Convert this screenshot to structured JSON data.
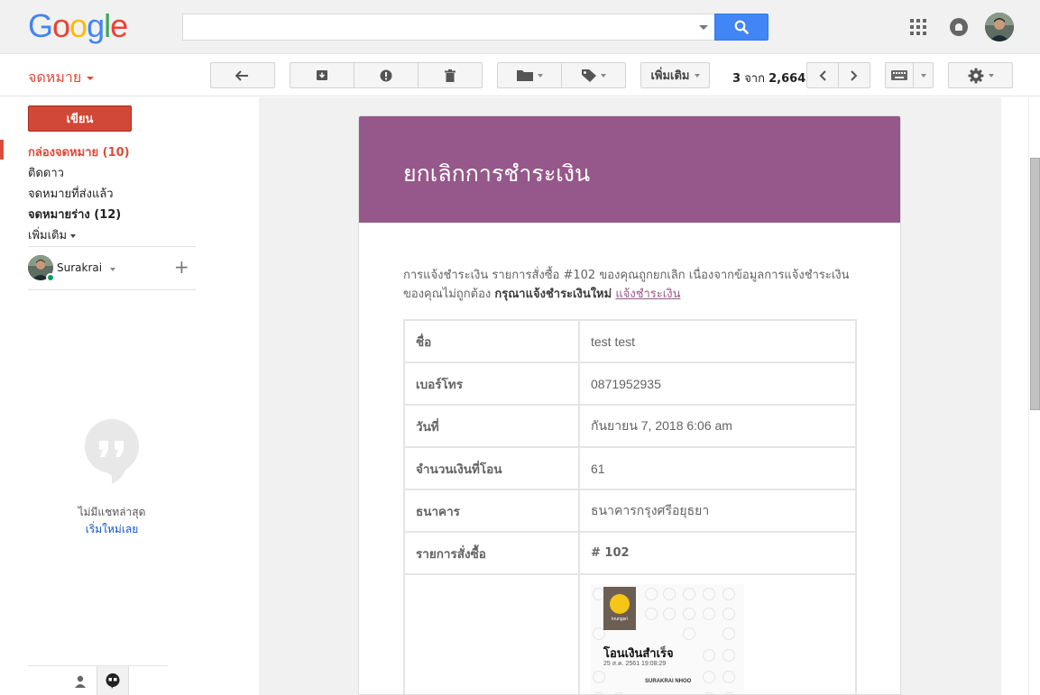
{
  "header": {
    "logo": [
      "G",
      "o",
      "o",
      "g",
      "l",
      "e"
    ],
    "logo_colors": [
      "#4285f4",
      "#ea4335",
      "#fbbc05",
      "#4285f4",
      "#34a853",
      "#ea4335"
    ],
    "search": {
      "value": "",
      "placeholder": ""
    }
  },
  "toolbar": {
    "mail_label": "จดหมาย",
    "more_label": "เพิ่มเติม",
    "count_current": "3",
    "count_of": "จาก",
    "count_total": "2,664"
  },
  "sidebar": {
    "compose_label": "เขียน",
    "items": [
      {
        "label": "กล่องจดหมาย (10)"
      },
      {
        "label": "ติดดาว"
      },
      {
        "label": "จดหมายที่ส่งแล้ว"
      },
      {
        "label": "จดหมายร่าง (12)"
      },
      {
        "label": "เพิ่มเติม"
      }
    ],
    "hangouts_user": "Surakrai",
    "no_chats": "ไม่มีแชทล่าสุด",
    "start_chat": "เริ่มใหม่เลย"
  },
  "email": {
    "title": "ยกเลิกการชำระเงิน",
    "intro_text": "การแจ้งชำระเงิน รายการสั่งซื้อ #102 ของคุณถูกยกเลิก เนื่องจากข้อมูลการแจ้งชำระเงินของคุณไม่ถูกต้อง",
    "intro_bold": "กรุณาแจ้งชำระเงินใหม่",
    "intro_link": "แจ้งชำระเงิน",
    "rows": [
      {
        "key": "ชื่อ",
        "value": "test test"
      },
      {
        "key": "เบอร์โทร",
        "value": "0871952935"
      },
      {
        "key": "วันที่",
        "value": "กันยายน 7, 2018 6:06 am"
      },
      {
        "key": "จำนวนเงินที่โอน",
        "value": "61"
      },
      {
        "key": "ธนาคาร",
        "value": "ธนาคารกรุงศรีอยุธยา"
      },
      {
        "key": "รายการสั่งซื้อ",
        "value": "# 102"
      }
    ],
    "slip": {
      "logo_text": "krungsri",
      "heading": "โอนเงินสำเร็จ",
      "datetime": "25 ส.ค. 2561 19:08:29",
      "name": "SURAKRAI NHOO"
    }
  },
  "colors": {
    "accent_red": "#dd4b39",
    "search_blue": "#4285f4",
    "email_header": "#96588a"
  }
}
